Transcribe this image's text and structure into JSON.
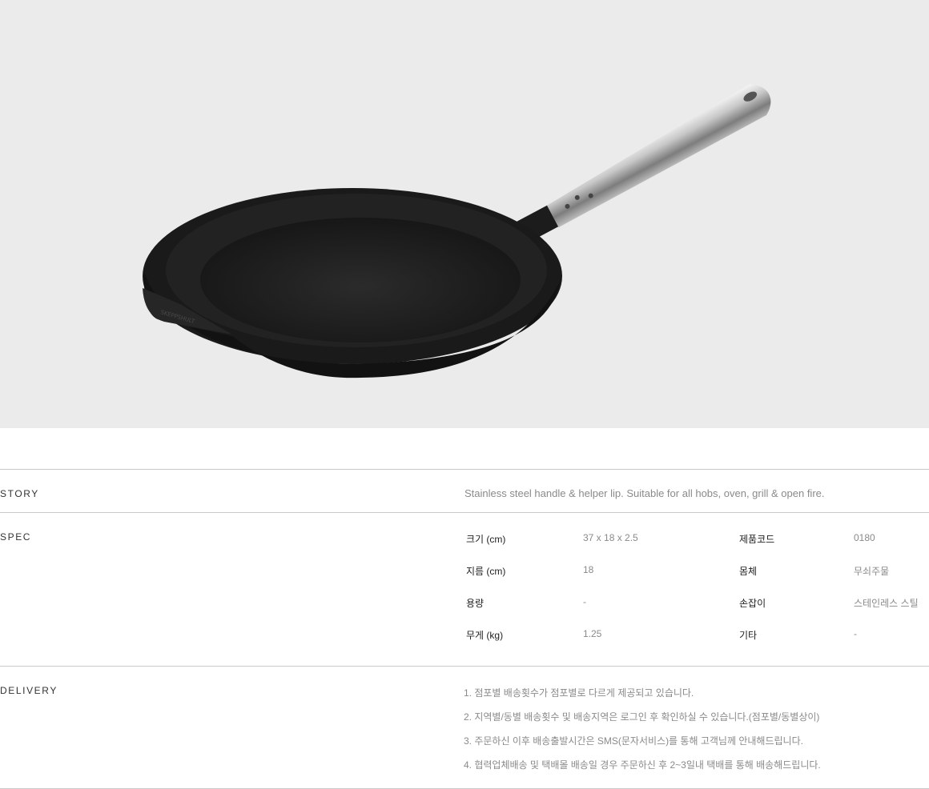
{
  "product_image": {
    "name": "pan-image"
  },
  "story": {
    "title": "STORY",
    "text": "Stainless steel handle & helper lip. Suitable for all hobs, oven, grill & open fire."
  },
  "spec": {
    "title": "SPEC",
    "rows": [
      {
        "label": "크기 (cm)",
        "value": "37 x 18 x 2.5",
        "label2": "제품코드",
        "value2": "0180"
      },
      {
        "label": "지름 (cm)",
        "value": "18",
        "label2": "몸체",
        "value2": "무쇠주물"
      },
      {
        "label": "용량",
        "value": "-",
        "label2": "손잡이",
        "value2": "스테인레스 스틸"
      },
      {
        "label": "무게 (kg)",
        "value": "1.25",
        "label2": "기타",
        "value2": "-"
      }
    ]
  },
  "delivery": {
    "title": "DELIVERY",
    "items": [
      "1. 점포별 배송횟수가 점포별로 다르게 제공되고 있습니다.",
      "2. 지역별/동별 배송횟수 및 배송지역은 로그인 후 확인하실 수 있습니다.(점포별/동별상이)",
      "3. 주문하신 이후 배송출발시간은 SMS(문자서비스)를 통해 고객님께 안내해드립니다.",
      "4. 협력업체배송 및 택배몰 배송일 경우 주문하신 후 2~3일내 택배를 통해 배송해드립니다."
    ]
  }
}
